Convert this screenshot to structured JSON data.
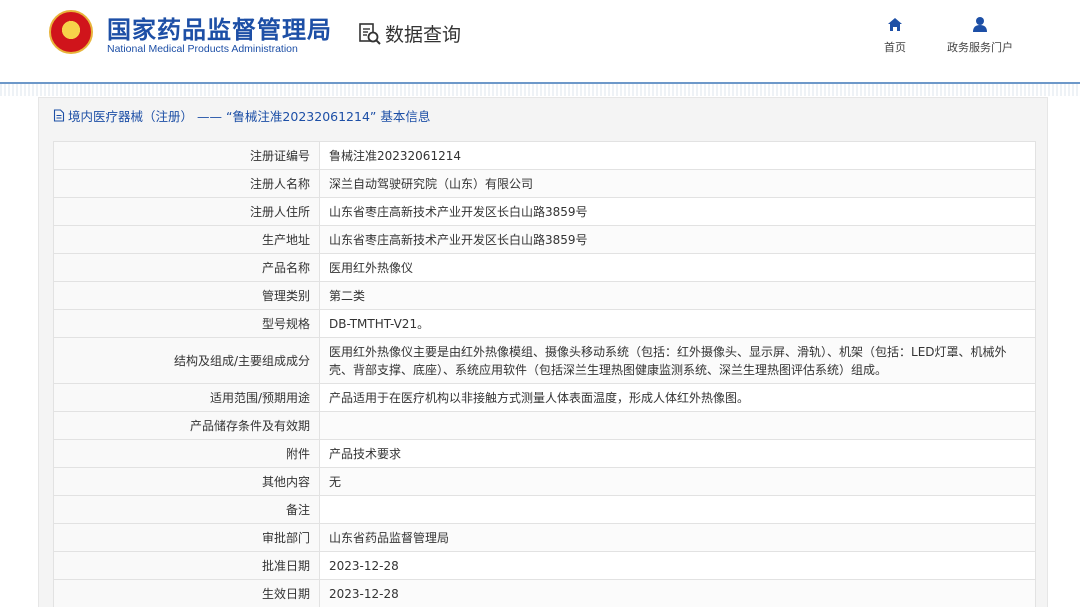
{
  "header": {
    "org_name_cn": "国家药品监督管理局",
    "org_name_en": "National Medical Products Administration",
    "query_label": "数据查询",
    "nav": [
      {
        "label": "首页",
        "icon": "home-icon"
      },
      {
        "label": "政务服务门户",
        "icon": "user-icon"
      }
    ]
  },
  "panel": {
    "title": "境内医疗器械（注册） —— “鲁械注准20232061214” 基本信息"
  },
  "rows": [
    {
      "label": "注册证编号",
      "value": "鲁械注准20232061214"
    },
    {
      "label": "注册人名称",
      "value": "深兰自动驾驶研究院（山东）有限公司"
    },
    {
      "label": "注册人住所",
      "value": "山东省枣庄高新技术产业开发区长白山路3859号"
    },
    {
      "label": "生产地址",
      "value": "山东省枣庄高新技术产业开发区长白山路3859号"
    },
    {
      "label": "产品名称",
      "value": "医用红外热像仪"
    },
    {
      "label": "管理类别",
      "value": "第二类"
    },
    {
      "label": "型号规格",
      "value": "DB-TMTHT-V21。"
    },
    {
      "label": "结构及组成/主要组成成分",
      "value": "医用红外热像仪主要是由红外热像模组、摄像头移动系统（包括：红外摄像头、显示屏、滑轨）、机架（包括：LED灯罩、机械外壳、背部支撑、底座）、系统应用软件（包括深兰生理热图健康监测系统、深兰生理热图评估系统）组成。"
    },
    {
      "label": "适用范围/预期用途",
      "value": "产品适用于在医疗机构以非接触方式测量人体表面温度，形成人体红外热像图。"
    },
    {
      "label": "产品储存条件及有效期",
      "value": ""
    },
    {
      "label": "附件",
      "value": "产品技术要求"
    },
    {
      "label": "其他内容",
      "value": "无"
    },
    {
      "label": "备注",
      "value": ""
    },
    {
      "label": "审批部门",
      "value": "山东省药品监督管理局"
    },
    {
      "label": "批准日期",
      "value": "2023-12-28"
    },
    {
      "label": "生效日期",
      "value": "2023-12-28"
    }
  ]
}
